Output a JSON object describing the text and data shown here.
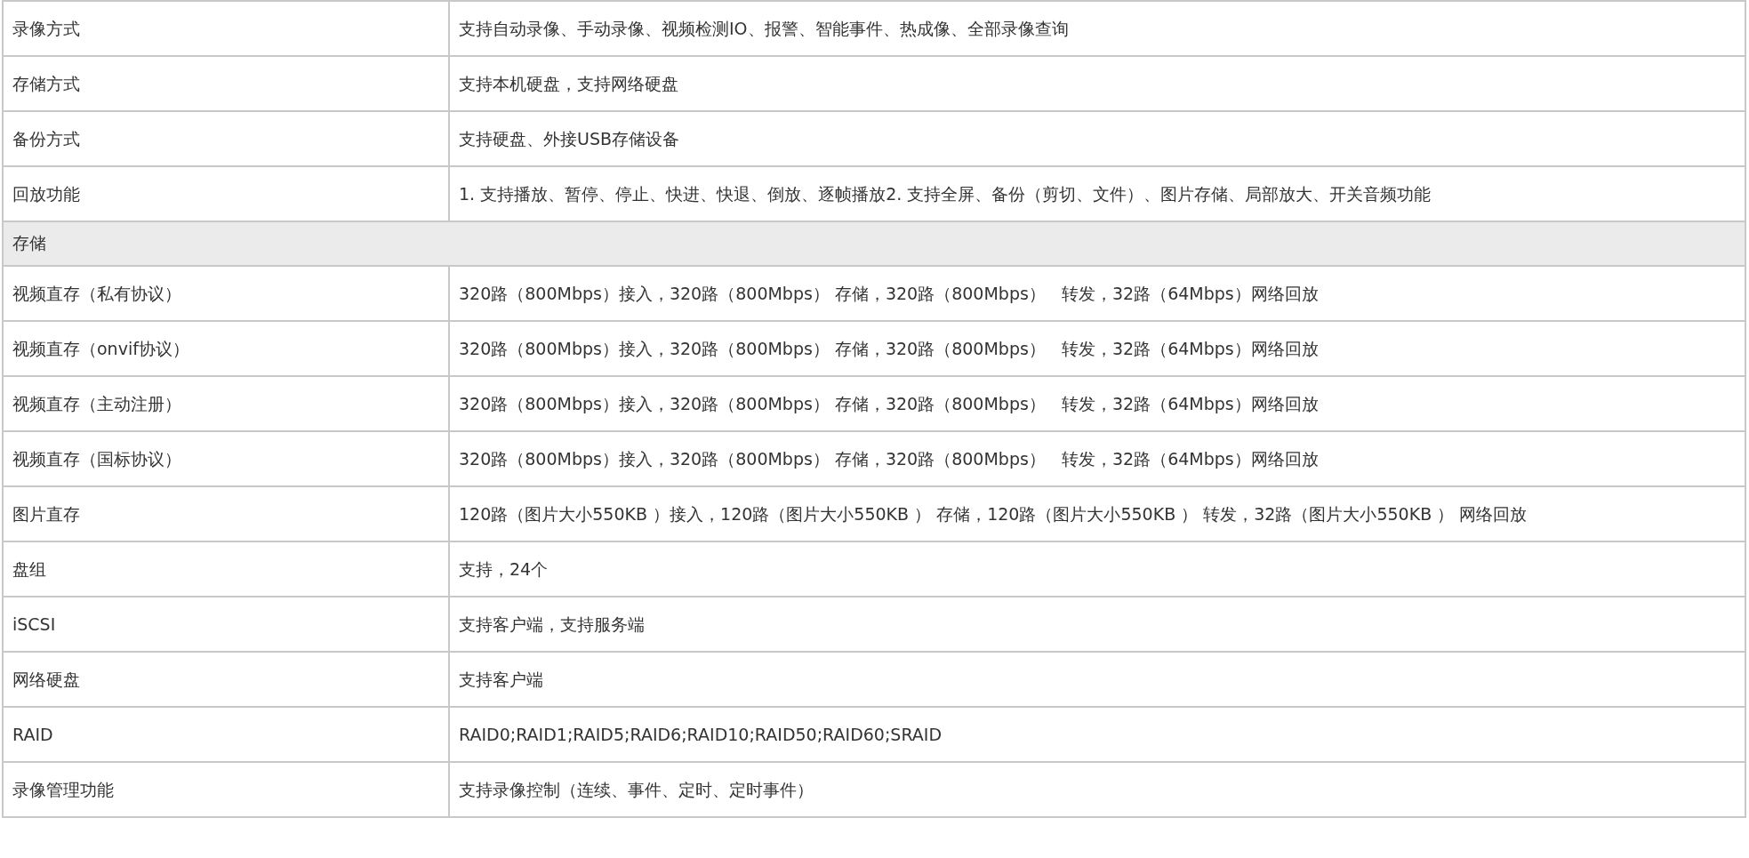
{
  "table": {
    "rows": [
      {
        "kind": "row",
        "label": "录像方式",
        "value": "支持自动录像、手动录像、视频检测IO、报警、智能事件、热成像、全部录像查询"
      },
      {
        "kind": "row",
        "label": "存储方式",
        "value": "支持本机硬盘，支持网络硬盘"
      },
      {
        "kind": "row",
        "label": "备份方式",
        "value": "支持硬盘、外接USB存储设备"
      },
      {
        "kind": "row",
        "label": "回放功能",
        "value": "1. 支持播放、暂停、停止、快进、快退、倒放、逐帧播放2. 支持全屏、备份（剪切、文件）、图片存储、局部放大、开关音频功能"
      },
      {
        "kind": "section",
        "label": "存储"
      },
      {
        "kind": "row",
        "label": "视频直存（私有协议）",
        "value": "320路（800Mbps）接入，320路（800Mbps） 存储，320路（800Mbps）   转发，32路（64Mbps）网络回放"
      },
      {
        "kind": "row",
        "label": "视频直存（onvif协议）",
        "value": "320路（800Mbps）接入，320路（800Mbps） 存储，320路（800Mbps）   转发，32路（64Mbps）网络回放"
      },
      {
        "kind": "row",
        "label": "视频直存（主动注册）",
        "value": "320路（800Mbps）接入，320路（800Mbps） 存储，320路（800Mbps）   转发，32路（64Mbps）网络回放"
      },
      {
        "kind": "row",
        "label": "视频直存（国标协议）",
        "value": "320路（800Mbps）接入，320路（800Mbps） 存储，320路（800Mbps）   转发，32路（64Mbps）网络回放"
      },
      {
        "kind": "row",
        "label": "图片直存",
        "value": "120路（图片大小550KB ）接入，120路（图片大小550KB ） 存储，120路（图片大小550KB ） 转发，32路（图片大小550KB ） 网络回放"
      },
      {
        "kind": "row",
        "label": "盘组",
        "value": "支持，24个"
      },
      {
        "kind": "row",
        "label": "iSCSI",
        "value": "支持客户端，支持服务端"
      },
      {
        "kind": "row",
        "label": "网络硬盘",
        "value": "支持客户端"
      },
      {
        "kind": "row",
        "label": "RAID",
        "value": "RAID0;RAID1;RAID5;RAID6;RAID10;RAID50;RAID60;SRAID"
      },
      {
        "kind": "row",
        "label": "录像管理功能",
        "value": "支持录像控制（连续、事件、定时、定时事件）"
      }
    ]
  }
}
